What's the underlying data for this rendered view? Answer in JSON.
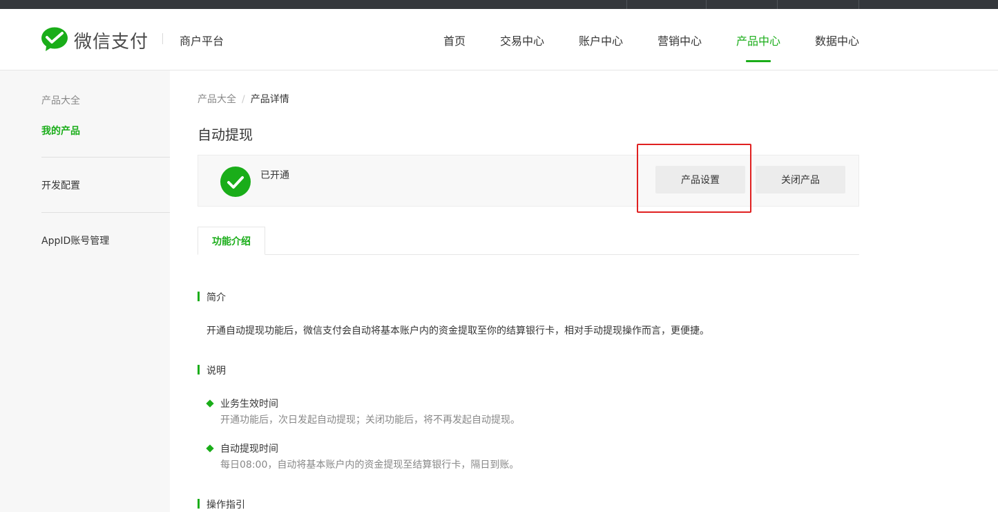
{
  "brand": {
    "logo_text": "微信支付",
    "platform": "商户平台",
    "accent_color": "#1aad19"
  },
  "nav": {
    "items": [
      {
        "label": "首页"
      },
      {
        "label": "交易中心"
      },
      {
        "label": "账户中心"
      },
      {
        "label": "营销中心"
      },
      {
        "label": "产品中心",
        "active": true
      },
      {
        "label": "数据中心"
      }
    ]
  },
  "sidebar": {
    "items": [
      {
        "label": "产品大全"
      },
      {
        "label": "我的产品",
        "active": true
      },
      {
        "label": "开发配置"
      },
      {
        "label": "AppID账号管理"
      }
    ]
  },
  "breadcrumb": {
    "parent": "产品大全",
    "separator": "/",
    "current": "产品详情"
  },
  "product": {
    "title": "自动提现",
    "status": "已开通",
    "status_icon": "check-circle-icon",
    "settings_button": "产品设置",
    "close_button": "关闭产品"
  },
  "tabs": [
    {
      "label": "功能介绍",
      "active": true
    }
  ],
  "sections": {
    "intro": {
      "title": "简介",
      "text": "开通自动提现功能后，微信支付会自动将基本账户内的资金提取至你的结算银行卡，相对手动提现操作而言，更便捷。"
    },
    "notes": {
      "title": "说明",
      "items": [
        {
          "title": "业务生效时间",
          "desc": "开通功能后，次日发起自动提现；关闭功能后，将不再发起自动提现。"
        },
        {
          "title": "自动提现时间",
          "desc": "每日08:00，自动将基本账户内的资金提现至结算银行卡，隔日到账。"
        }
      ]
    },
    "guide": {
      "title": "操作指引"
    }
  }
}
